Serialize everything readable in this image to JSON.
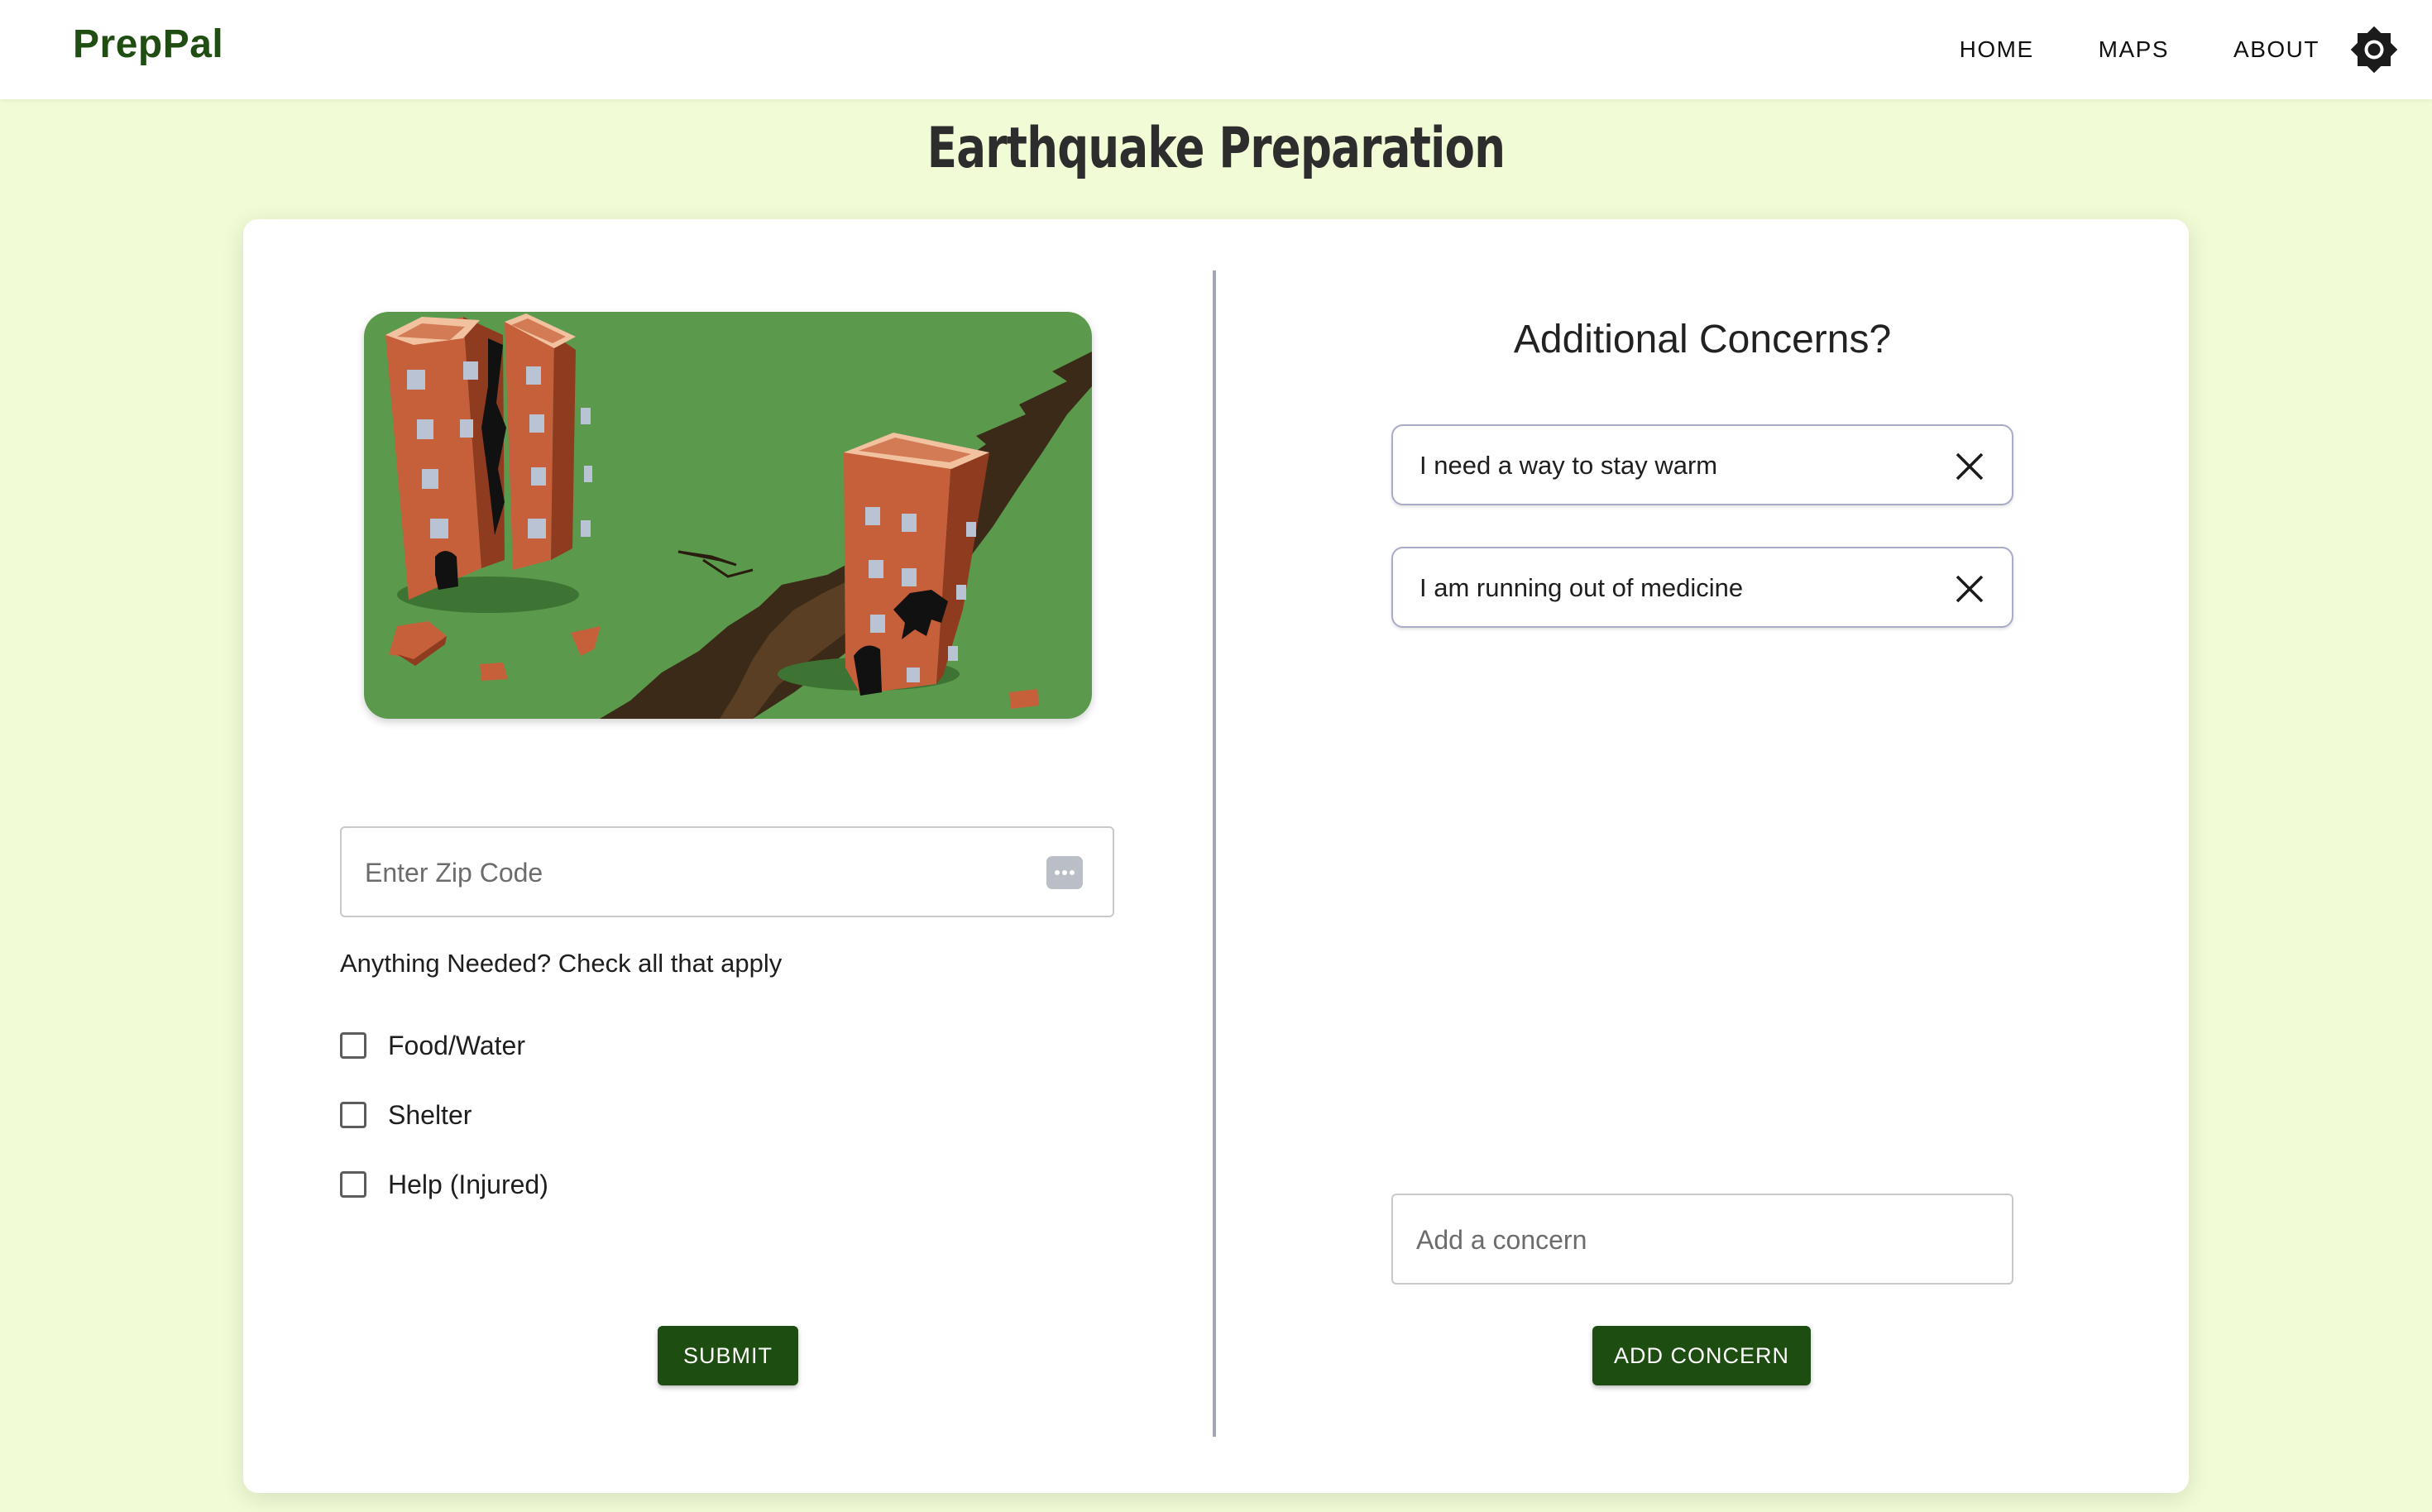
{
  "nav": {
    "brand": "PrepPal",
    "links": [
      "HOME",
      "MAPS",
      "ABOUT"
    ],
    "theme_icon": "brightness-icon"
  },
  "page": {
    "title": "Earthquake Preparation"
  },
  "form": {
    "image_icon": "earthquake-illustration",
    "zip_placeholder": "Enter Zip Code",
    "needs_label": "Anything Needed? Check all that apply",
    "options": [
      {
        "label": "Food/Water",
        "checked": false
      },
      {
        "label": "Shelter",
        "checked": false
      },
      {
        "label": "Help (Injured)",
        "checked": false
      }
    ],
    "submit_label": "SUBMIT"
  },
  "concerns": {
    "title": "Additional Concerns?",
    "items": [
      "I need a way to stay warm",
      "I am running out of medicine"
    ],
    "input_placeholder": "Add a concern",
    "add_label": "ADD CONCERN"
  },
  "colors": {
    "page_background": "#f1fcd6",
    "brand_green": "#1e4d12",
    "illustration_green": "#5b9a4d",
    "building_brick": "#c5603a"
  }
}
